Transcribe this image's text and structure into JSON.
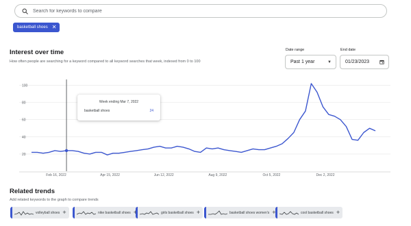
{
  "search": {
    "placeholder": "Search for keywords to compare",
    "icon": "search-icon"
  },
  "chip": {
    "label": "basketball shoes",
    "color": "#3b56cf"
  },
  "interest": {
    "title": "Interest over time",
    "subtitle": "How often people are searching for a keyword compared to all keyword searches that week, indexed from 0 to 100",
    "date_range_label": "Date range",
    "date_range_value": "Past 1 year",
    "end_date_label": "End date",
    "end_date_value": "01/23/2023"
  },
  "tooltip": {
    "date": "Week ending Mar 7, 2022",
    "term": "basketball shoes",
    "value": "24"
  },
  "chart_data": {
    "type": "line",
    "series": [
      {
        "name": "basketball shoes",
        "color": "#3b56cf",
        "values": [
          22,
          22,
          21,
          22,
          24,
          23,
          24,
          24,
          23,
          21,
          20,
          22,
          22,
          19,
          21,
          21,
          22,
          23,
          24,
          25,
          26,
          28,
          29,
          27,
          27,
          29,
          28,
          26,
          23,
          22,
          27,
          26,
          27,
          25,
          24,
          23,
          22,
          24,
          26,
          25,
          25,
          27,
          29,
          32,
          38,
          45,
          60,
          70,
          102,
          92,
          75,
          66,
          64,
          60,
          52,
          37,
          36,
          45,
          50,
          47
        ]
      }
    ],
    "x_tick_labels": [
      "Feb 16, 2022",
      "Apr 15, 2022",
      "Jun 12, 2022",
      "Aug 9, 2022",
      "Oct 5, 2022",
      "Dec 2, 2022"
    ],
    "y_ticks": [
      20,
      40,
      60,
      80,
      100
    ],
    "ylim": [
      0,
      110
    ],
    "hover_index": 6,
    "grid": true
  },
  "related": {
    "title": "Related trends",
    "subtitle": "Add related keywords to the graph to compare trends",
    "items": [
      {
        "label": "volleyball shoes"
      },
      {
        "label": "nike basketball shoes"
      },
      {
        "label": "girls basketball shoes"
      },
      {
        "label": "basketball shoes women's"
      },
      {
        "label": "cool basketball shoes"
      }
    ]
  }
}
